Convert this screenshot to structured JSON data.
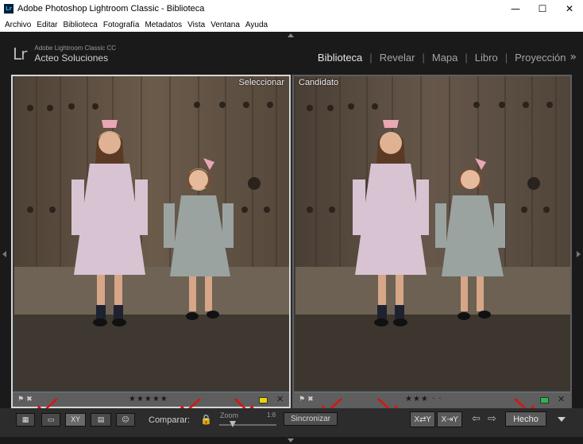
{
  "window": {
    "title": "Adobe Photoshop Lightroom Classic - Biblioteca",
    "app_icon": "Lr",
    "controls": [
      "minimize-icon",
      "maximize-icon",
      "close-icon"
    ]
  },
  "menu": [
    {
      "label": "Archivo"
    },
    {
      "label": "Editar"
    },
    {
      "label": "Biblioteca"
    },
    {
      "label": "Fotografía"
    },
    {
      "label": "Metadatos"
    },
    {
      "label": "Vista"
    },
    {
      "label": "Ventana"
    },
    {
      "label": "Ayuda"
    }
  ],
  "identity": {
    "logo": "Lr",
    "product": "Adobe Lightroom Classic CC",
    "name": "Acteo Soluciones"
  },
  "modules": [
    {
      "label": "Biblioteca",
      "active": true
    },
    {
      "label": "Revelar"
    },
    {
      "label": "Mapa"
    },
    {
      "label": "Libro"
    },
    {
      "label": "Proyección"
    }
  ],
  "modules_more": "»",
  "panes": {
    "select": {
      "label": "Seleccionar",
      "stars": "★★★★★",
      "rating": 5,
      "color_label": "#e8d800",
      "close": "✕"
    },
    "candidate": {
      "label": "Candidato",
      "stars": "★★★ · ·",
      "rating": 3,
      "color_label": "#2fb64a",
      "close": "✕"
    }
  },
  "toolbar": {
    "compare_label": "Comparar:",
    "zoom_label": "Zoom",
    "zoom_ratio": "1:8",
    "sync_label": "Sincronizar",
    "done_label": "Hecho",
    "icons": [
      "grid-view-icon",
      "loupe-view-icon",
      "compare-view-icon",
      "survey-view-icon",
      "people-view-icon"
    ]
  },
  "colors": {
    "annotation": "#e01010",
    "background": "#1a1a1a"
  }
}
